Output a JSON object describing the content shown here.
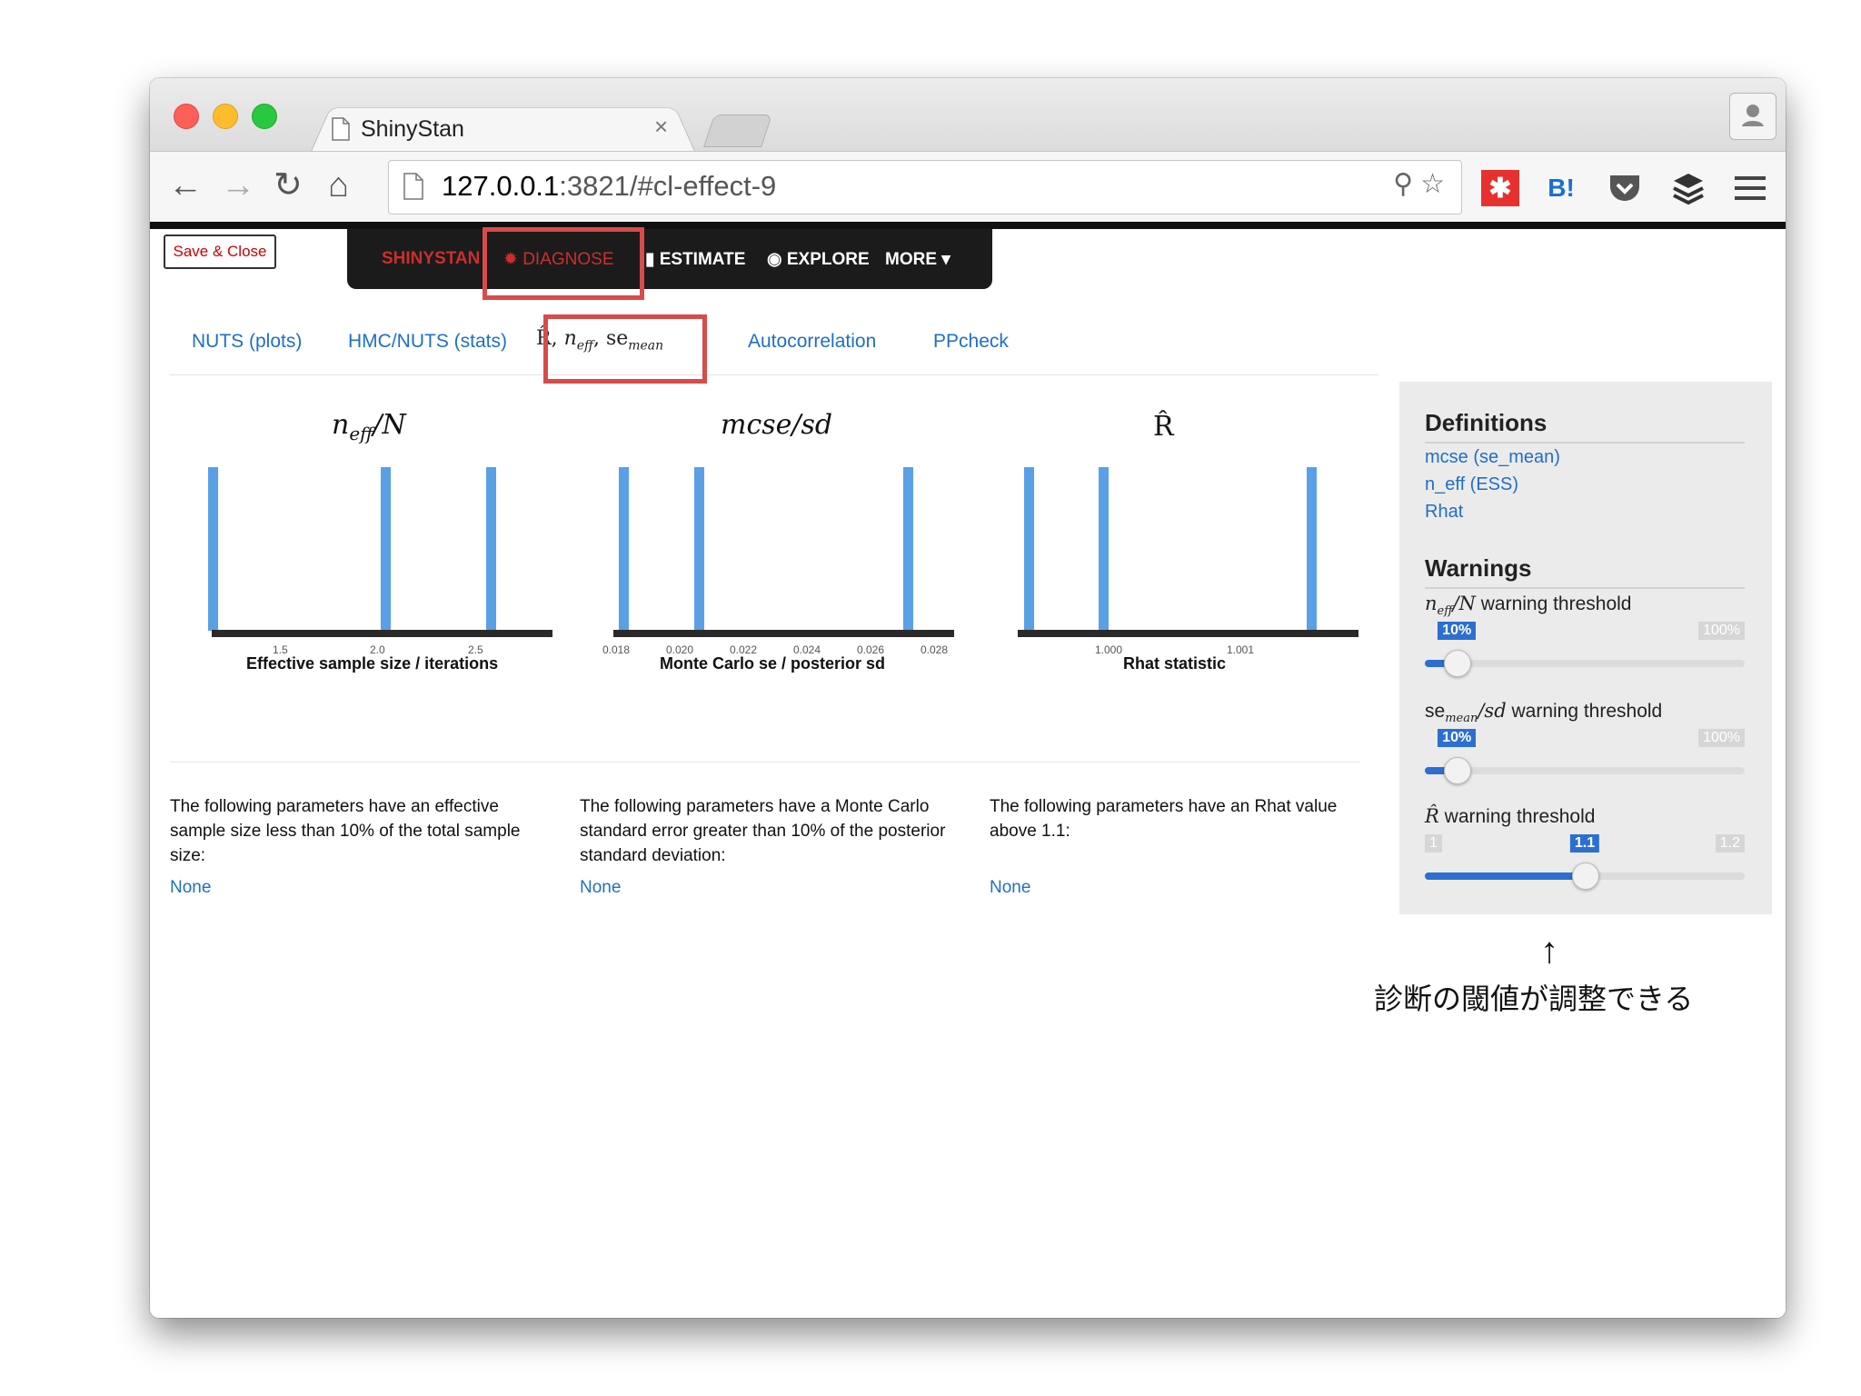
{
  "browser": {
    "tab_title": "ShinyStan",
    "tab_close": "×",
    "url": "127.0.0.1:3821/#cl-effect-9",
    "url_host": "127.0.0.1",
    "url_rest": ":3821/#cl-effect-9",
    "extension_labels": [
      "B!"
    ]
  },
  "app": {
    "save_close": "Save & Close",
    "nav": {
      "brand": "SHINYSTAN",
      "diagnose": "DIAGNOSE",
      "estimate": "ESTIMATE",
      "explore": "EXPLORE",
      "more": "MORE"
    },
    "subtabs": [
      "NUTS (plots)",
      "HMC/NUTS (stats)",
      "R̂, n",
      "Autocorrelation",
      "PPcheck"
    ],
    "subtab_rhat": {
      "r": "R̂, ",
      "n": "n",
      "eff": "eff",
      "comma": ", se",
      "mean": "mean"
    },
    "plots": [
      {
        "title_main": "n",
        "title_sub": "eff",
        "title_tail": "/N",
        "xlabel": "Effective sample size / iterations",
        "ticks": [
          "1.5",
          "2.0",
          "2.5"
        ]
      },
      {
        "title_main": "mcse/sd",
        "title_sub": "",
        "title_tail": "",
        "xlabel": "Monte Carlo se / posterior sd",
        "ticks": [
          "0.018",
          "0.020",
          "0.022",
          "0.024",
          "0.026",
          "0.028"
        ]
      },
      {
        "title_main": "R̂",
        "title_sub": "",
        "title_tail": "",
        "xlabel": "Rhat statistic",
        "ticks": [
          "1.000",
          "1.001"
        ]
      }
    ],
    "paragraphs": [
      "The following parameters have an effective sample size less than 10% of the total sample size:",
      "The following parameters have a Monte Carlo standard error greater than 10% of the posterior standard deviation:",
      "The following parameters have an Rhat value above 1.1:"
    ],
    "none_label": "None",
    "sidebar": {
      "definitions_title": "Definitions",
      "links": [
        "mcse (se_mean)",
        "n_eff (ESS)",
        "Rhat"
      ],
      "warnings_title": "Warnings",
      "sliders": [
        {
          "label_tail": " warning threshold",
          "value_label": "10%",
          "max_label": "100%",
          "min_label": "",
          "fraction": 0.1
        },
        {
          "label_tail": " warning threshold",
          "value_label": "10%",
          "max_label": "100%",
          "min_label": "",
          "fraction": 0.1
        },
        {
          "label_tail": " warning threshold",
          "value_label": "1.1",
          "max_label": "1.2",
          "min_label": "1",
          "fraction": 0.5
        }
      ],
      "slider_label_parts": [
        {
          "a": "n",
          "b": "eff",
          "c": "/N"
        },
        {
          "a": "se",
          "b": "mean",
          "c": "/sd"
        },
        {
          "a": "R̂",
          "b": "",
          "c": ""
        }
      ]
    }
  },
  "annotation": {
    "arrow": "↑",
    "text": "診断の閾値が調整できる"
  },
  "colors": {
    "accent": "#2c6fd0",
    "highlight": "#d94b4b",
    "bar": "#5aa0e6",
    "nav_bg": "#1b1b1b"
  }
}
